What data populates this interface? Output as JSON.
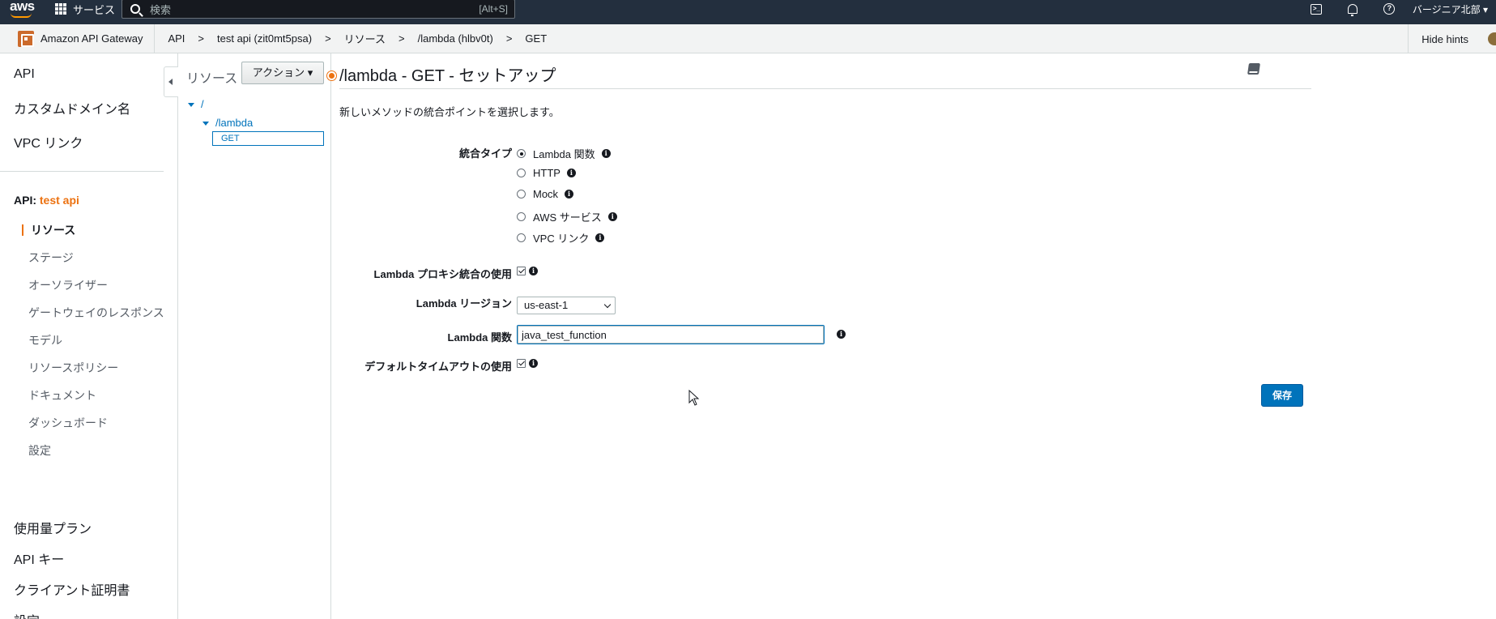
{
  "topnav": {
    "logo": "aws",
    "services_label": "サービス",
    "search_placeholder": "検索",
    "search_shortcut": "[Alt+S]",
    "region": "バージニア北部 ▾",
    "icons": [
      "cloudshell-icon",
      "bell-icon",
      "help-icon"
    ]
  },
  "breadcrumbs": {
    "service": "Amazon API Gateway",
    "items": [
      "API",
      "test api (zit0mt5psa)",
      "リソース",
      "/lambda (hlbv0t)",
      "GET"
    ],
    "hide_hints": "Hide hints"
  },
  "sidebar": {
    "top_items": [
      "API",
      "カスタムドメイン名",
      "VPC リンク"
    ],
    "api_prefix": "API: ",
    "api_name": "test api",
    "sub_items": [
      "リソース",
      "ステージ",
      "オーソライザー",
      "ゲートウェイのレスポンス",
      "モデル",
      "リソースポリシー",
      "ドキュメント",
      "ダッシュボード",
      "設定"
    ],
    "active_sub_item": "リソース",
    "bottom_items": [
      "使用量プラン",
      "API キー",
      "クライアント証明書",
      "設定"
    ]
  },
  "tree": {
    "title": "リソース",
    "actions_label": "アクション ▾",
    "nodes": [
      "/",
      "/lambda",
      "GET"
    ]
  },
  "main": {
    "title": "/lambda - GET - セットアップ",
    "description": "新しいメソッドの統合ポイントを選択します。",
    "integration_type_label": "統合タイプ",
    "integration_types": [
      "Lambda 関数",
      "HTTP",
      "Mock",
      "AWS サービス",
      "VPC リンク"
    ],
    "selected_integration_type": "Lambda 関数",
    "proxy_label": "Lambda プロキシ統合の使用",
    "proxy_checked": true,
    "region_label": "Lambda リージョン",
    "region_value": "us-east-1",
    "function_label": "Lambda 関数",
    "function_value": "java_test_function",
    "timeout_label": "デフォルトタイムアウトの使用",
    "timeout_checked": true,
    "save_label": "保存"
  },
  "colors": {
    "topnav_bg": "#232f3e",
    "accent_orange": "#ec7211",
    "link_blue": "#0073bb",
    "primary_button": "#0073bb"
  }
}
